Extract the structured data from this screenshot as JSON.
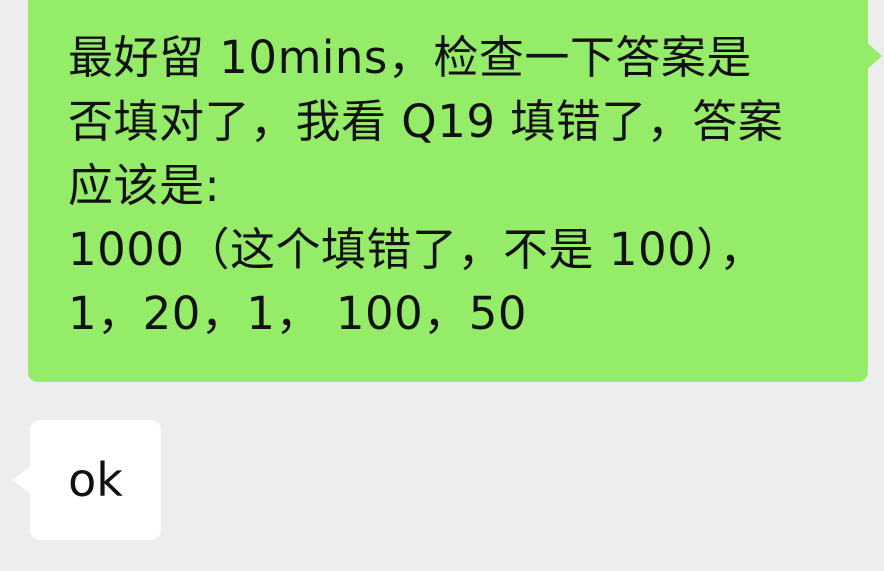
{
  "chat": {
    "outgoing_message": {
      "lines": [
        "最好留 10mins，检查一下答案是",
        "否填对了，我看 Q19 填错了，答案",
        "应该是:",
        "1000（这个填错了，不是 100），",
        "1，20，1， 100，50"
      ]
    },
    "incoming_message": {
      "text": "ok"
    }
  },
  "colors": {
    "background": "#ededed",
    "outgoing_bubble": "#95ec69",
    "incoming_bubble": "#ffffff",
    "text": "#111111"
  }
}
